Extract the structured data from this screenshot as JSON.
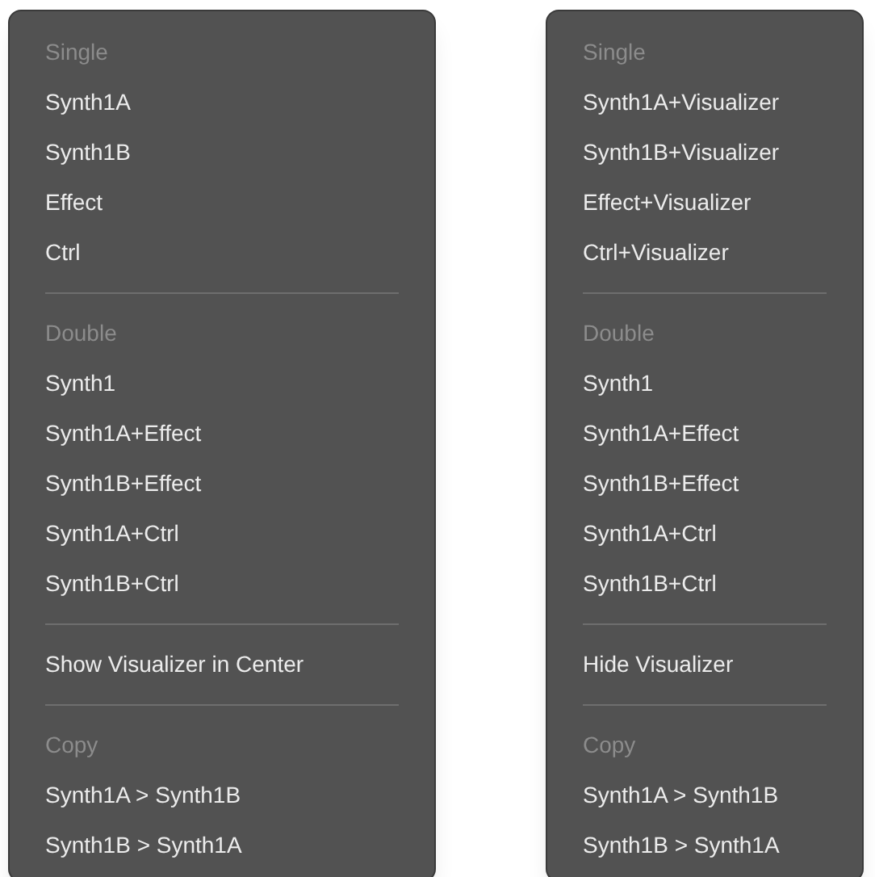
{
  "menus": [
    {
      "items": [
        {
          "kind": "header",
          "label": "Single"
        },
        {
          "kind": "item",
          "label": "Synth1A"
        },
        {
          "kind": "item",
          "label": "Synth1B"
        },
        {
          "kind": "item",
          "label": "Effect"
        },
        {
          "kind": "item",
          "label": "Ctrl"
        },
        {
          "kind": "separator"
        },
        {
          "kind": "header",
          "label": "Double"
        },
        {
          "kind": "item",
          "label": "Synth1"
        },
        {
          "kind": "item",
          "label": "Synth1A+Effect"
        },
        {
          "kind": "item",
          "label": "Synth1B+Effect"
        },
        {
          "kind": "item",
          "label": "Synth1A+Ctrl"
        },
        {
          "kind": "item",
          "label": "Synth1B+Ctrl"
        },
        {
          "kind": "separator"
        },
        {
          "kind": "item",
          "label": "Show Visualizer in Center"
        },
        {
          "kind": "separator"
        },
        {
          "kind": "header",
          "label": "Copy"
        },
        {
          "kind": "item",
          "label": "Synth1A > Synth1B"
        },
        {
          "kind": "item",
          "label": "Synth1B > Synth1A"
        }
      ]
    },
    {
      "items": [
        {
          "kind": "header",
          "label": "Single"
        },
        {
          "kind": "item",
          "label": "Synth1A+Visualizer"
        },
        {
          "kind": "item",
          "label": "Synth1B+Visualizer"
        },
        {
          "kind": "item",
          "label": "Effect+Visualizer"
        },
        {
          "kind": "item",
          "label": "Ctrl+Visualizer"
        },
        {
          "kind": "separator"
        },
        {
          "kind": "header",
          "label": "Double"
        },
        {
          "kind": "item",
          "label": "Synth1"
        },
        {
          "kind": "item",
          "label": "Synth1A+Effect"
        },
        {
          "kind": "item",
          "label": "Synth1B+Effect"
        },
        {
          "kind": "item",
          "label": "Synth1A+Ctrl"
        },
        {
          "kind": "item",
          "label": "Synth1B+Ctrl"
        },
        {
          "kind": "separator"
        },
        {
          "kind": "item",
          "label": "Hide Visualizer"
        },
        {
          "kind": "separator"
        },
        {
          "kind": "header",
          "label": "Copy"
        },
        {
          "kind": "item",
          "label": "Synth1A > Synth1B"
        },
        {
          "kind": "item",
          "label": "Synth1B > Synth1A"
        }
      ]
    }
  ]
}
